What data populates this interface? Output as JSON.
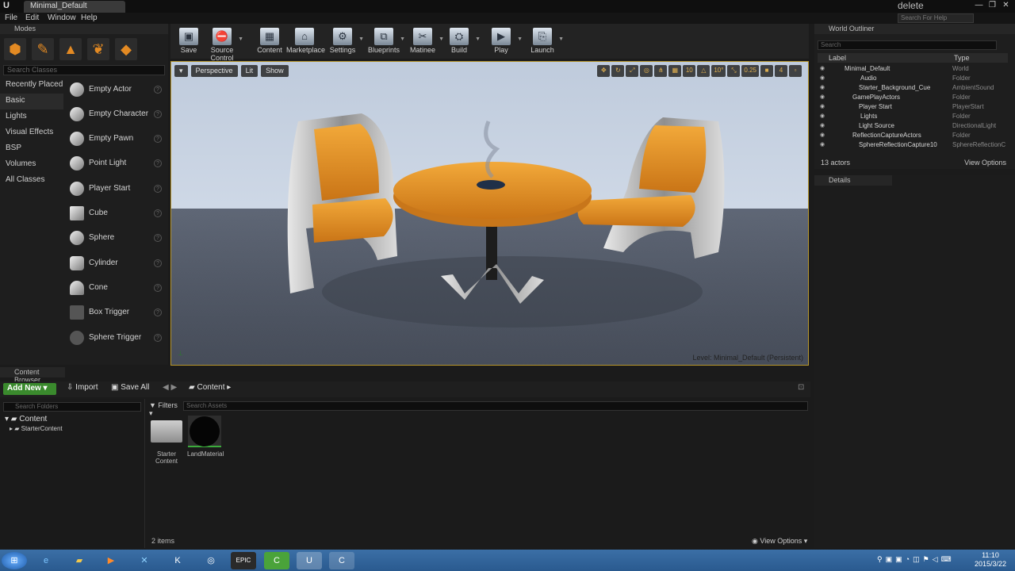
{
  "window": {
    "tab_title": "Minimal_Default",
    "controls": [
      "—",
      "❐",
      "✕"
    ],
    "search_help_placeholder": "Search For Help",
    "overlay_hint": "delete"
  },
  "menu": [
    "File",
    "Edit",
    "Window",
    "Help"
  ],
  "modes": {
    "title": "Modes",
    "search_placeholder": "Search Classes",
    "categories": [
      "Recently Placed",
      "Basic",
      "Lights",
      "Visual Effects",
      "BSP",
      "Volumes",
      "All Classes"
    ],
    "active_category": "Basic",
    "items": [
      "Empty Actor",
      "Empty Character",
      "Empty Pawn",
      "Point Light",
      "Player Start",
      "Cube",
      "Sphere",
      "Cylinder",
      "Cone",
      "Box Trigger",
      "Sphere Trigger"
    ]
  },
  "toolbar": [
    "Save",
    "Source Control",
    "Content",
    "Marketplace",
    "Settings",
    "Blueprints",
    "Matinee",
    "Build",
    "Play",
    "Launch"
  ],
  "viewport": {
    "perspective": "Perspective",
    "lit": "Lit",
    "show": "Show",
    "grid_snap": "10",
    "rot_snap": "10°",
    "scale_snap": "0.25",
    "camera_speed": "4",
    "level_label": "Level:  Minimal_Default (Persistent)"
  },
  "outliner": {
    "title": "World Outliner",
    "search_placeholder": "Search",
    "col_label": "Label",
    "col_type": "Type",
    "rows": [
      {
        "label": "Minimal_Default",
        "type": "World"
      },
      {
        "label": "Audio",
        "type": "Folder"
      },
      {
        "label": "Starter_Background_Cue",
        "type": "AmbientSound"
      },
      {
        "label": "GamePlayActors",
        "type": "Folder"
      },
      {
        "label": "Player Start",
        "type": "PlayerStart"
      },
      {
        "label": "Lights",
        "type": "Folder"
      },
      {
        "label": "Light Source",
        "type": "DirectionalLight"
      },
      {
        "label": "ReflectionCaptureActors",
        "type": "Folder"
      },
      {
        "label": "SphereReflectionCapture10",
        "type": "SphereReflectionC"
      }
    ],
    "actor_count": "13 actors",
    "view_options": "View Options"
  },
  "details": {
    "title": "Details"
  },
  "content_browser": {
    "title": "Content Browser",
    "add_new": "Add New",
    "import": "Import",
    "save_all": "Save All",
    "path": "Content",
    "search_folders_placeholder": "Search Folders",
    "filters": "Filters",
    "search_assets_placeholder": "Search Assets",
    "tree_root": "Content",
    "tree_child": "StarterContent",
    "assets": [
      {
        "name": "Starter Content",
        "kind": "folder"
      },
      {
        "name": "LandMaterial",
        "kind": "material"
      }
    ],
    "item_count": "2 items",
    "view_options": "View Options"
  },
  "taskbar": {
    "apps": [
      "start-orb",
      "ie",
      "explorer",
      "media",
      "xsplit",
      "k",
      "browser",
      "epic",
      "camtasia",
      "unreal",
      "c-app"
    ],
    "time": "11:10",
    "date": "2015/3/22"
  }
}
